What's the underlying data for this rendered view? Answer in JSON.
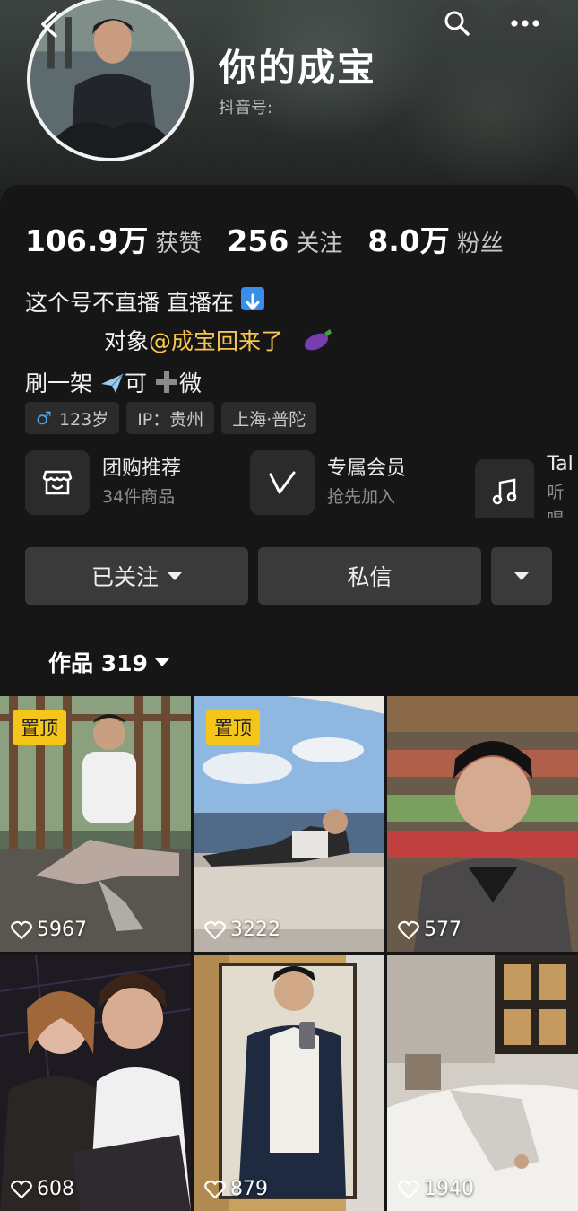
{
  "profile": {
    "nickname": "你的成宝",
    "douyin_id_label": "抖音号:"
  },
  "stats": [
    {
      "value": "106.9万",
      "label": "获赞"
    },
    {
      "value": "256",
      "label": "关注"
    },
    {
      "value": "8.0万",
      "label": "粉丝"
    }
  ],
  "bio": {
    "line1": "这个号不直播 直播在",
    "line2_prefix": "对象",
    "line2_mention": "@成宝回来了",
    "line3_a": "刷一架",
    "line3_b": "可",
    "line3_c": "微"
  },
  "tags": [
    {
      "icon": "male-icon",
      "text": "123岁"
    },
    {
      "text": "IP：贵州"
    },
    {
      "text": "上海·普陀"
    }
  ],
  "services": [
    {
      "icon": "shop-icon",
      "title": "团购推荐",
      "subtitle": "34件商品"
    },
    {
      "icon": "vip-icon",
      "title": "专属会员",
      "subtitle": "抢先加入"
    },
    {
      "icon": "music-icon",
      "title": "Tal",
      "subtitle": "听喝"
    }
  ],
  "actions": {
    "follow_label": "已关注",
    "message_label": "私信"
  },
  "works_tab": {
    "label": "作品 319"
  },
  "videos": [
    {
      "pinned": true,
      "pin_label": "置顶",
      "likes": "5967"
    },
    {
      "pinned": true,
      "pin_label": "置顶",
      "likes": "3222"
    },
    {
      "pinned": false,
      "likes": "577"
    },
    {
      "pinned": false,
      "likes": "608"
    },
    {
      "pinned": false,
      "likes": "879"
    },
    {
      "pinned": false,
      "likes": "1940"
    }
  ],
  "colors": {
    "background": "#161616",
    "mention": "#f6c64d",
    "pin_badge": "#f5c51c",
    "male": "#4aa3e6"
  }
}
